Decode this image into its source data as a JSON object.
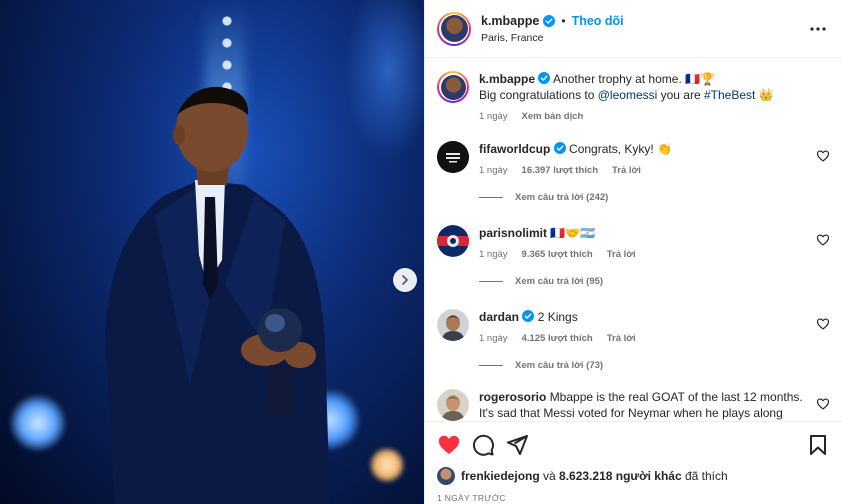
{
  "post": {
    "author": "k.mbappe",
    "follow_label": "Theo dõi",
    "separator": "•",
    "location": "Paris, France",
    "more_icon": "more-horizontal-icon"
  },
  "caption": {
    "username": "k.mbappe",
    "line1": "Another trophy at home. 🇫🇷🏆",
    "line2_prefix": "Big congratulations to ",
    "mention": "@leomessi",
    "line2_middle": " you are ",
    "hashtag": "#TheBest",
    "line2_suffix": " 👑",
    "time": "1 ngày",
    "translate": "Xem bản dịch"
  },
  "comments": [
    {
      "username": "fifaworldcup",
      "text": "Congrats, Kyky! 👏",
      "time": "1 ngày",
      "likes": "16.397 lượt thích",
      "reply": "Trả lời",
      "replies": "Xem câu trả lời (242)"
    },
    {
      "username": "parisnolimit",
      "text": "🇫🇷🤝🇦🇷",
      "time": "1 ngày",
      "likes": "9.365 lượt thích",
      "reply": "Trả lời",
      "replies": "Xem câu trả lời (95)"
    },
    {
      "username": "dardan",
      "text": "2 Kings",
      "time": "1 ngày",
      "likes": "4.125 lượt thích",
      "reply": "Trả lời",
      "replies": "Xem câu trả lời (73)"
    },
    {
      "username": "rogerosorio",
      "text": "Mbappe is the real GOAT of the last 12 months. It's sad that Messi voted for Neymar when he plays along side",
      "time": "",
      "likes": "",
      "reply": "",
      "replies": ""
    }
  ],
  "likes": {
    "user": "frenkiedejong",
    "connector": " và ",
    "count": "8.623.218 người khác",
    "suffix": " đã thích"
  },
  "timestamp": "1 NGÀY TRƯỚC",
  "colors": {
    "accent": "#0095f6",
    "like_red": "#ff3040",
    "verified": "#0095f6"
  }
}
